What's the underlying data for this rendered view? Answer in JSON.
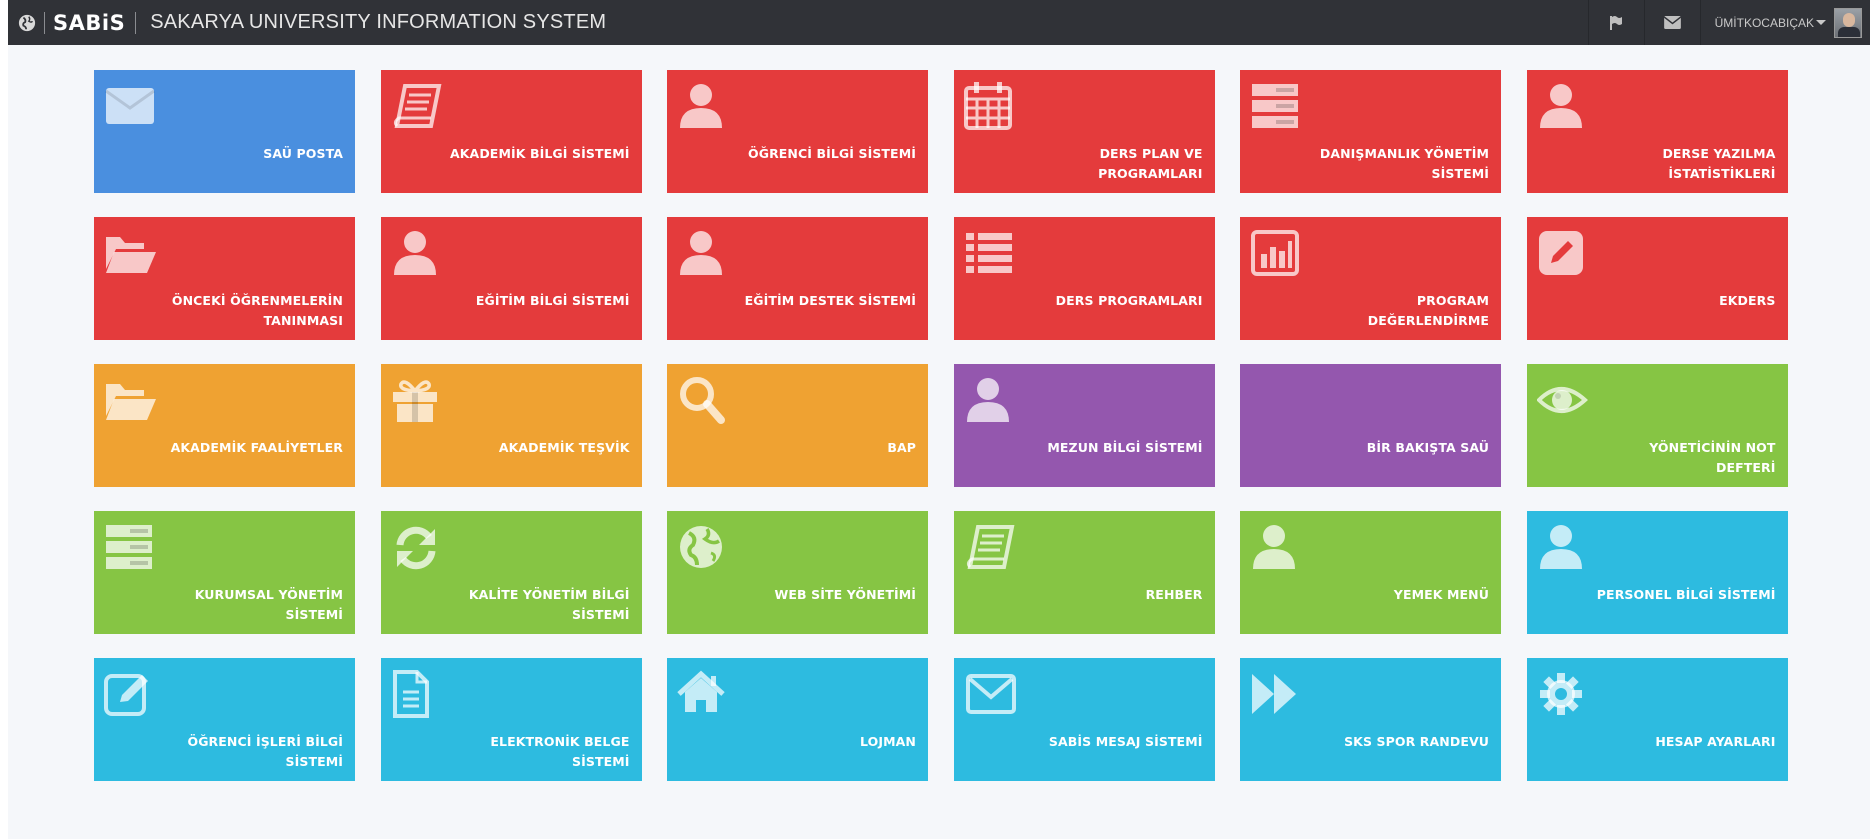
{
  "header": {
    "logo": "SABiS",
    "title": "SAKARYA UNIVERSITY INFORMATION SYSTEM",
    "user_name": "ÜMİTKOCABIÇAK"
  },
  "colors": {
    "blue": "#4a8fdf",
    "red": "#e43b3c",
    "orange": "#efa232",
    "purple": "#9457ae",
    "green": "#86c544",
    "cyan": "#2dbbe0",
    "navbar": "#303237"
  },
  "tiles": [
    {
      "label": "SAÜ POSTA",
      "color": "blue",
      "icon": "envelope-icon"
    },
    {
      "label": "AKADEMİK BİLGİ SİSTEMİ",
      "color": "red",
      "icon": "book-icon"
    },
    {
      "label": "ÖĞRENCİ BİLGİ SİSTEMİ",
      "color": "red",
      "icon": "user-icon"
    },
    {
      "label": "DERS PLAN VE PROGRAMLARI",
      "color": "red",
      "icon": "calendar-icon"
    },
    {
      "label": "DANIŞMANLIK YÖNETİM SİSTEMİ",
      "color": "red",
      "icon": "server-icon"
    },
    {
      "label": "DERSE YAZILMA İSTATİSTİKLERİ",
      "color": "red",
      "icon": "user-icon"
    },
    {
      "label": "ÖNCEKİ ÖĞRENMELERİN TANINMASI",
      "color": "red",
      "icon": "folder-open-icon"
    },
    {
      "label": "EĞİTİM BİLGİ SİSTEMİ",
      "color": "red",
      "icon": "user-icon"
    },
    {
      "label": "EĞİTİM DESTEK SİSTEMİ",
      "color": "red",
      "icon": "user-icon"
    },
    {
      "label": "DERS PROGRAMLARI",
      "color": "red",
      "icon": "list-icon"
    },
    {
      "label": "PROGRAM DEĞERLENDİRME",
      "color": "red",
      "icon": "bar-chart-icon"
    },
    {
      "label": "EKDERS",
      "color": "red",
      "icon": "pencil-square-icon"
    },
    {
      "label": "AKADEMİK FAALİYETLER",
      "color": "orange",
      "icon": "folder-open-icon"
    },
    {
      "label": "AKADEMİK TEŞVİK",
      "color": "orange",
      "icon": "gift-icon"
    },
    {
      "label": "BAP",
      "color": "orange",
      "icon": "search-icon"
    },
    {
      "label": "MEZUN BİLGİ SİSTEMİ",
      "color": "purple",
      "icon": "user-icon"
    },
    {
      "label": "BİR BAKIŞTA SAÜ",
      "color": "purple",
      "icon": ""
    },
    {
      "label": "YÖNETİCİNİN NOT DEFTERİ",
      "color": "green",
      "icon": "eye-icon"
    },
    {
      "label": "KURUMSAL YÖNETİM SİSTEMİ",
      "color": "green",
      "icon": "server-icon"
    },
    {
      "label": "KALİTE YÖNETİM BİLGİ SİSTEMİ",
      "color": "green",
      "icon": "refresh-icon"
    },
    {
      "label": "WEB SİTE YÖNETİMİ",
      "color": "green",
      "icon": "globe-icon"
    },
    {
      "label": "REHBER",
      "color": "green",
      "icon": "book-icon"
    },
    {
      "label": "YEMEK MENÜ",
      "color": "green",
      "icon": "user-icon"
    },
    {
      "label": "PERSONEL BİLGİ SİSTEMİ",
      "color": "cyan",
      "icon": "user-icon"
    },
    {
      "label": "ÖĞRENCİ İŞLERİ BİLGİ SİSTEMİ",
      "color": "cyan",
      "icon": "edit-icon"
    },
    {
      "label": "ELEKTRONİK BELGE SİSTEMİ",
      "color": "cyan",
      "icon": "file-text-icon"
    },
    {
      "label": "LOJMAN",
      "color": "cyan",
      "icon": "home-icon"
    },
    {
      "label": "SABİS MESAJ SİSTEMİ",
      "color": "cyan",
      "icon": "envelope-outline-icon"
    },
    {
      "label": "SKS SPOR RANDEVU",
      "color": "cyan",
      "icon": "fast-forward-icon"
    },
    {
      "label": "HESAP AYARLARI",
      "color": "cyan",
      "icon": "gear-icon"
    }
  ]
}
